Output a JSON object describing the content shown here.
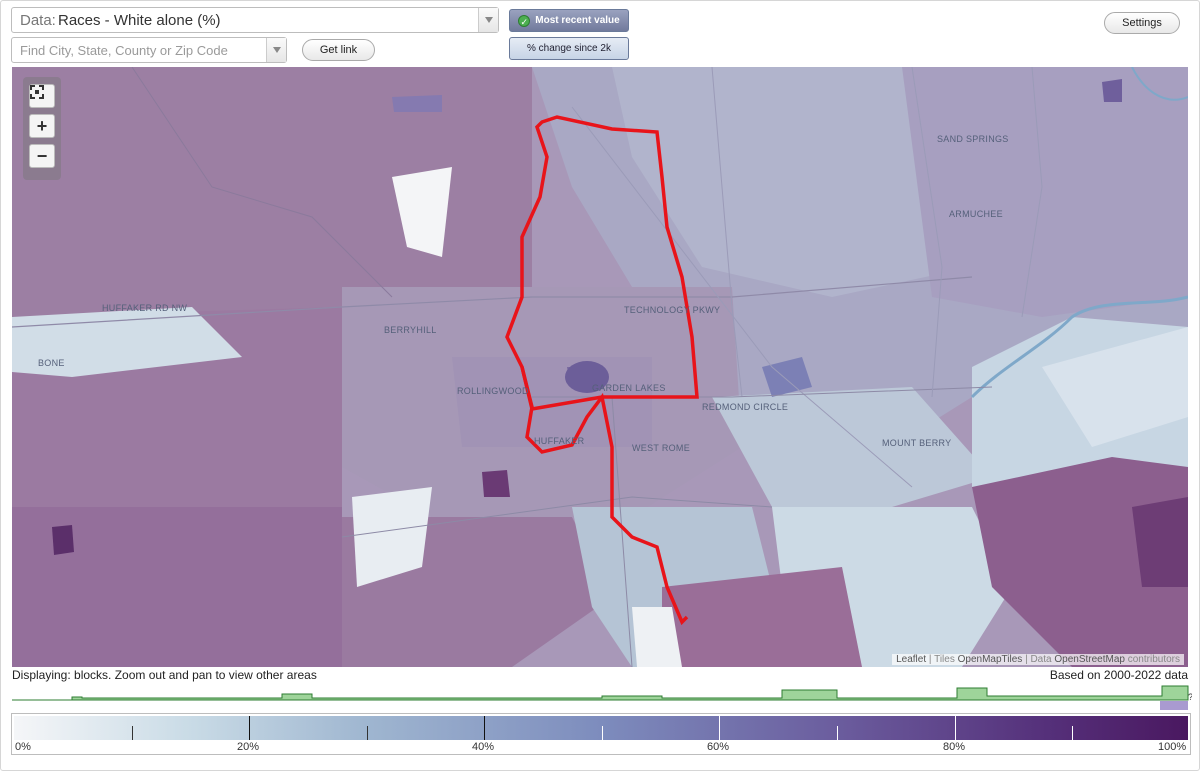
{
  "header": {
    "data_label": "Data:",
    "data_value": "Races - White alone (%)",
    "search_placeholder": "Find City, State, County or Zip Code",
    "get_link": "Get link",
    "settings": "Settings",
    "toggle_active": "Most recent value",
    "toggle_inactive": "% change since 2k"
  },
  "map": {
    "places": [
      "SAND SPRINGS",
      "ARMUCHEE",
      "BERRYHILL",
      "ROLLINGWOOD",
      "GARDEN LAKES",
      "TECHNOLOGY PKWY",
      "HUFFAKER",
      "WEST ROME",
      "REDMOND CIRCLE",
      "MOUNT BERRY",
      "BONE",
      "HUFFAKER RD NW"
    ],
    "attribution": {
      "leaflet": "Leaflet",
      "tiles_prefix": "| Tiles",
      "tiles": "OpenMapTiles",
      "data_prefix": "| Data",
      "osm": "OpenStreetMap",
      "contributors": "contributors"
    },
    "zoom_icons": [
      "fullscreen-icon",
      "zoom-in-icon",
      "zoom-out-icon"
    ],
    "zoom_in": "+",
    "zoom_out": "−"
  },
  "footer": {
    "displaying": "Displaying: blocks. Zoom out and pan to view other areas",
    "based_on": "Based on 2000-2022 data",
    "histogram_marker": "?"
  },
  "legend": {
    "labels": [
      "0%",
      "20%",
      "40%",
      "60%",
      "80%",
      "100%"
    ],
    "colors": {
      "low": "#f5f6f8",
      "mid": "#7d8cbd",
      "high": "#4a1860"
    }
  },
  "colors": {
    "route": "#e8141a",
    "histogram": "#9ed49a",
    "histogram_line": "#2e7d32"
  }
}
